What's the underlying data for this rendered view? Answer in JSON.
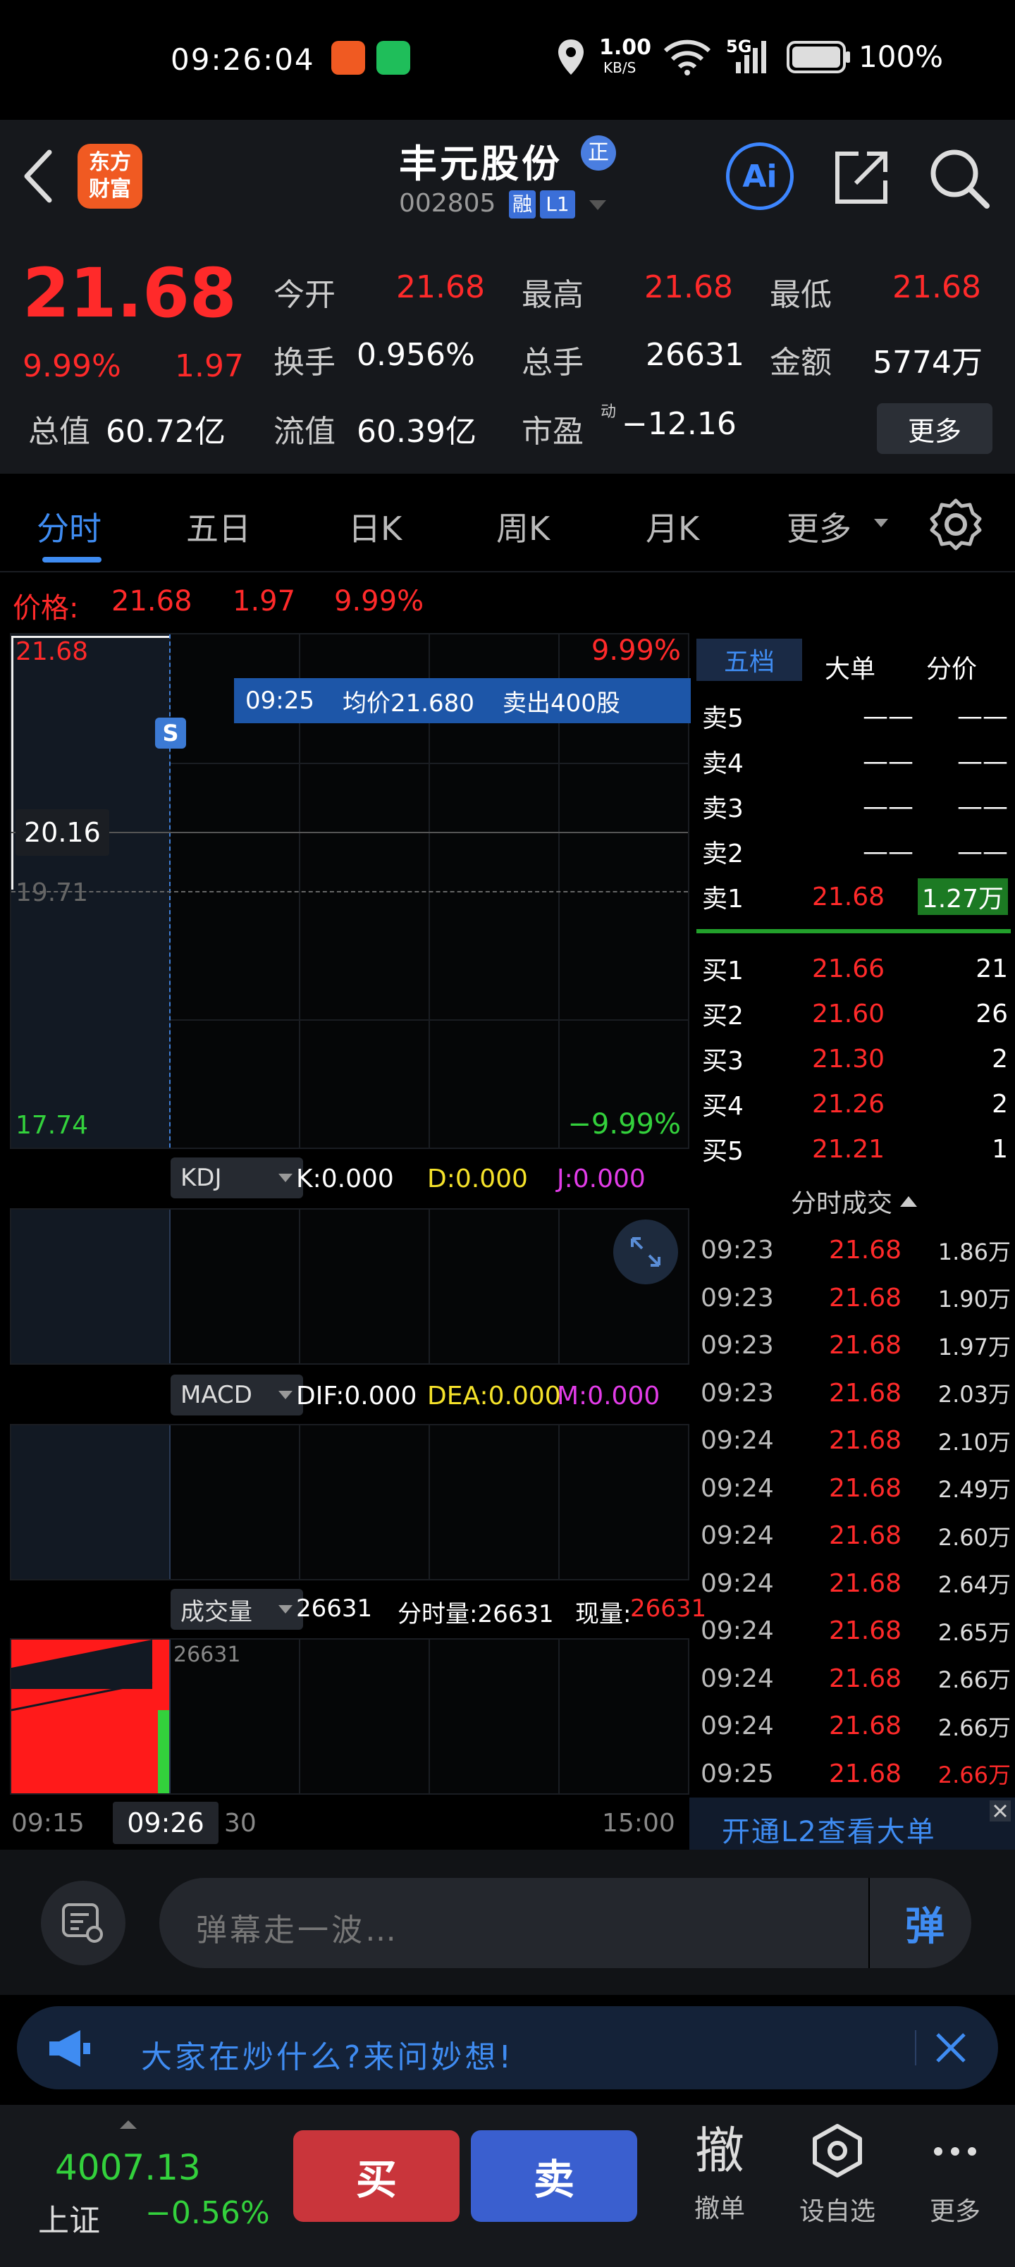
{
  "status_bar": {
    "time": "09:26:04",
    "net_speed_value": "1.00",
    "net_speed_unit": "KB/S",
    "signal": "5G",
    "battery": "100%"
  },
  "header": {
    "logo_line1": "东方",
    "logo_line2": "财富",
    "stock_name": "丰元股份",
    "badge_zheng": "正",
    "stock_code": "002805",
    "tag_rong": "融",
    "tag_l1": "L1",
    "ai_label": "Ai"
  },
  "quote": {
    "price": "21.68",
    "change_pct": "9.99%",
    "change": "1.97",
    "open_label": "今开",
    "open": "21.68",
    "high_label": "最高",
    "high": "21.68",
    "low_label": "最低",
    "low": "21.68",
    "turnover_label": "换手",
    "turnover": "0.956%",
    "volume_label": "总手",
    "volume": "26631",
    "amount_label": "金额",
    "amount": "5774万",
    "mktcap_label": "总值",
    "mktcap": "60.72亿",
    "float_label": "流值",
    "float_cap": "60.39亿",
    "pe_label": "市盈",
    "pe_sup": "动",
    "pe": "−12.16",
    "more_button": "更多"
  },
  "tabs": [
    {
      "label": "分时"
    },
    {
      "label": "五日"
    },
    {
      "label": "日K"
    },
    {
      "label": "周K"
    },
    {
      "label": "月K"
    },
    {
      "label": "更多"
    }
  ],
  "price_bar": {
    "label": "价格:",
    "price": "21.68",
    "change": "1.97",
    "pct": "9.99%"
  },
  "chart": {
    "top_price": "21.68",
    "top_pct": "9.99%",
    "cross_price": "20.16",
    "ref_price": "19.71",
    "bottom_price": "17.74",
    "bottom_pct": "−9.99%",
    "tooltip_time": "09:25",
    "tooltip_avg": "均价21.680",
    "tooltip_trade": "卖出400股",
    "sell_marker": "S"
  },
  "kdj": {
    "name": "KDJ",
    "k": "K:0.000",
    "d": "D:0.000",
    "j": "J:0.000"
  },
  "macd": {
    "name": "MACD",
    "dif": "DIF:0.000",
    "dea": "DEA:0.000",
    "m": "M:0.000"
  },
  "volume_panel": {
    "name": "成交量",
    "total": "26631",
    "fenshi": "分时量:26631",
    "xian": "现量:",
    "xian_val": "26631",
    "axis_val": "26631"
  },
  "time_axis": {
    "start": "09:15",
    "cursor": "09:26",
    "mid": "30",
    "end": "15:00"
  },
  "orderbook": {
    "tabs": [
      "五档",
      "大单",
      "分价"
    ],
    "asks": [
      {
        "label": "卖5",
        "price": "——",
        "vol": "——"
      },
      {
        "label": "卖4",
        "price": "——",
        "vol": "——"
      },
      {
        "label": "卖3",
        "price": "——",
        "vol": "——"
      },
      {
        "label": "卖2",
        "price": "——",
        "vol": "——"
      },
      {
        "label": "卖1",
        "price": "21.68",
        "vol": "1.27万"
      }
    ],
    "bids": [
      {
        "label": "买1",
        "price": "21.66",
        "vol": "21"
      },
      {
        "label": "买2",
        "price": "21.60",
        "vol": "26"
      },
      {
        "label": "买3",
        "price": "21.30",
        "vol": "2"
      },
      {
        "label": "买4",
        "price": "21.26",
        "vol": "2"
      },
      {
        "label": "买5",
        "price": "21.21",
        "vol": "1"
      }
    ]
  },
  "trades_title": "分时成交",
  "trades": [
    {
      "time": "09:23",
      "price": "21.68",
      "vol": "1.86万"
    },
    {
      "time": "09:23",
      "price": "21.68",
      "vol": "1.90万"
    },
    {
      "time": "09:23",
      "price": "21.68",
      "vol": "1.97万"
    },
    {
      "time": "09:23",
      "price": "21.68",
      "vol": "2.03万"
    },
    {
      "time": "09:24",
      "price": "21.68",
      "vol": "2.10万"
    },
    {
      "time": "09:24",
      "price": "21.68",
      "vol": "2.49万"
    },
    {
      "time": "09:24",
      "price": "21.68",
      "vol": "2.60万"
    },
    {
      "time": "09:24",
      "price": "21.68",
      "vol": "2.64万"
    },
    {
      "time": "09:24",
      "price": "21.68",
      "vol": "2.65万"
    },
    {
      "time": "09:24",
      "price": "21.68",
      "vol": "2.66万"
    },
    {
      "time": "09:24",
      "price": "21.68",
      "vol": "2.66万"
    },
    {
      "time": "09:25",
      "price": "21.68",
      "vol": "2.66万"
    }
  ],
  "l2_banner": "开通L2查看大单",
  "danmu": {
    "placeholder": "弹幕走一波…",
    "send": "弹"
  },
  "promo": {
    "text": "大家在炒什么?来问妙想!"
  },
  "bottom": {
    "index_value": "4007.13",
    "index_name": "上证",
    "index_change": "−0.56%",
    "buy": "买",
    "sell": "卖",
    "cancel_icon_char": "撤",
    "cancel_label": "撤单",
    "watch_label": "设自选",
    "more_label": "更多"
  }
}
